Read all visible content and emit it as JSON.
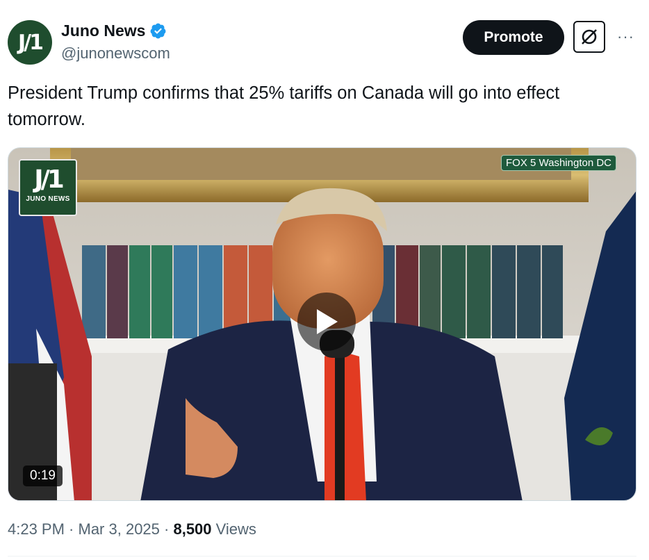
{
  "author": {
    "avatar_text": "J/1",
    "display_name": "Juno News",
    "handle": "@junonewscom",
    "verified_icon": "verified-badge-icon"
  },
  "actions": {
    "promote_label": "Promote",
    "grok_icon": "grok-icon",
    "more_icon": "more-options-icon",
    "more_glyph": "···"
  },
  "tweet": {
    "text": "President Trump confirms that 25% tariffs on Canada will go into effect tomorrow."
  },
  "media": {
    "watermark_logo": "J/1",
    "watermark_text": "JUNO NEWS",
    "station_label": "FOX 5 Washington DC",
    "duration": "0:19",
    "play_icon": "play-icon"
  },
  "meta": {
    "time": "4:23 PM",
    "sep1": " · ",
    "date": "Mar 3, 2025",
    "sep2": " · ",
    "views_count": "8,500",
    "views_label": " Views"
  },
  "colors": {
    "brand_green": "#1f4d2e",
    "verified_blue": "#1d9bf0",
    "text_primary": "#0f1419",
    "text_secondary": "#536471"
  }
}
